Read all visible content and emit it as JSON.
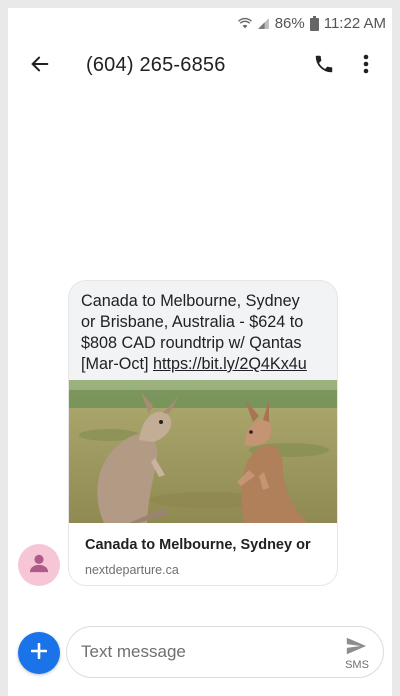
{
  "status_bar": {
    "battery": "86%",
    "time": "11:22 AM",
    "icons": [
      "wifi-icon",
      "cell-signal-icon",
      "battery-icon"
    ]
  },
  "app_bar": {
    "title": "(604) 265-6856",
    "icons": [
      "back-arrow-icon",
      "phone-icon",
      "more-vert-icon"
    ]
  },
  "message": {
    "text": "Canada to Melbourne, Sydney\nor Brisbane, Australia - $624 to\n$808 CAD roundtrip w/ Qantas\n[Mar-Oct] ",
    "link": "https://bit.ly/2Q4Kx4u",
    "preview": {
      "title": "Canada to Melbourne, Sydney or",
      "domain": "nextdeparture.ca",
      "image_subject": "kangaroos"
    }
  },
  "compose": {
    "placeholder": "Text message",
    "send_label": "SMS"
  },
  "colors": {
    "accent": "#1a73e8",
    "avatar_bg": "#f7c6d6",
    "avatar_fg": "#b05a8a",
    "bubble_bg": "#f1f3f4"
  }
}
